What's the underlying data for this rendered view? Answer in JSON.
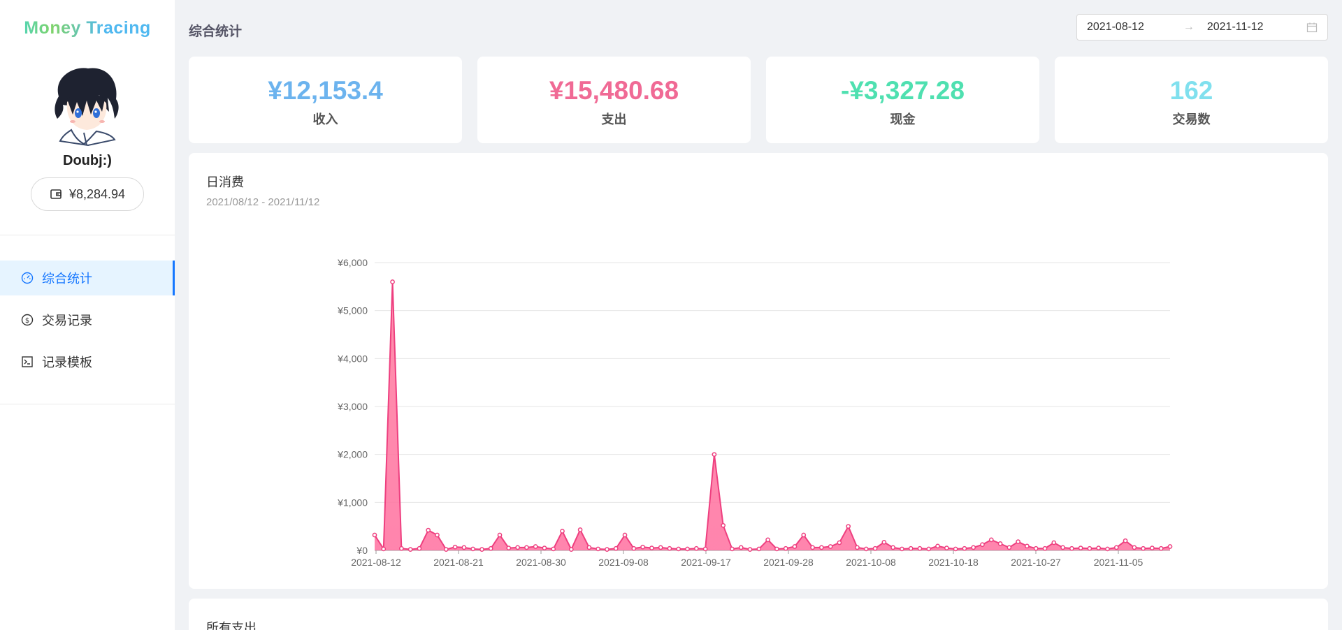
{
  "app": {
    "title": "Money Tracing"
  },
  "user": {
    "name": "Doubj:)",
    "balance": "¥8,284.94"
  },
  "sidebar": {
    "items": [
      {
        "label": "综合统计",
        "icon": "dashboard-icon",
        "active": true
      },
      {
        "label": "交易记录",
        "icon": "dollar-icon",
        "active": false
      },
      {
        "label": "记录模板",
        "icon": "code-icon",
        "active": false
      }
    ]
  },
  "header": {
    "title": "综合统计",
    "date_start": "2021-08-12",
    "date_end": "2021-11-12"
  },
  "stats": [
    {
      "value": "¥12,153.4",
      "label": "收入",
      "color": "#6cb3ee"
    },
    {
      "value": "¥15,480.68",
      "label": "支出",
      "color": "#f06a95"
    },
    {
      "value": "-¥3,327.28",
      "label": "现金",
      "color": "#4fe0b0"
    },
    {
      "value": "162",
      "label": "交易数",
      "color": "#80e0ee"
    }
  ],
  "daily_chart": {
    "title": "日消费",
    "subtitle": "2021/08/12 - 2021/11/12"
  },
  "bottom": {
    "title": "所有支出"
  },
  "colors": {
    "accent": "#1677ff",
    "line": "#ee3f7f",
    "area_top": "#ff8aa8",
    "area_bottom": "#ff6f9f"
  },
  "chart_data": {
    "type": "area",
    "ylim": [
      0,
      6000
    ],
    "yticks": [
      0,
      1000,
      2000,
      3000,
      4000,
      5000,
      6000
    ],
    "ytick_labels": [
      "¥0",
      "¥1,000",
      "¥2,000",
      "¥3,000",
      "¥4,000",
      "¥5,000",
      "¥6,000"
    ],
    "xtick_labels": [
      "2021-08-12",
      "2021-08-21",
      "2021-08-30",
      "2021-09-08",
      "2021-09-17",
      "2021-09-28",
      "2021-10-08",
      "2021-10-18",
      "2021-10-27",
      "2021-11-05"
    ],
    "grid": true,
    "series": [
      {
        "values": [
          320,
          30,
          5600,
          40,
          20,
          40,
          420,
          320,
          20,
          70,
          60,
          30,
          20,
          40,
          320,
          50,
          60,
          60,
          80,
          50,
          30,
          400,
          20,
          430,
          60,
          30,
          20,
          40,
          320,
          40,
          70,
          50,
          60,
          40,
          30,
          30,
          40,
          30,
          2000,
          520,
          30,
          60,
          20,
          30,
          220,
          30,
          40,
          80,
          320,
          60,
          60,
          80,
          160,
          500,
          60,
          30,
          40,
          170,
          60,
          30,
          40,
          40,
          30,
          90,
          50,
          30,
          40,
          60,
          120,
          220,
          140,
          60,
          180,
          90,
          40,
          40,
          160,
          60,
          40,
          50,
          40,
          50,
          30,
          60,
          200,
          60,
          40,
          50,
          40,
          80
        ]
      }
    ]
  }
}
